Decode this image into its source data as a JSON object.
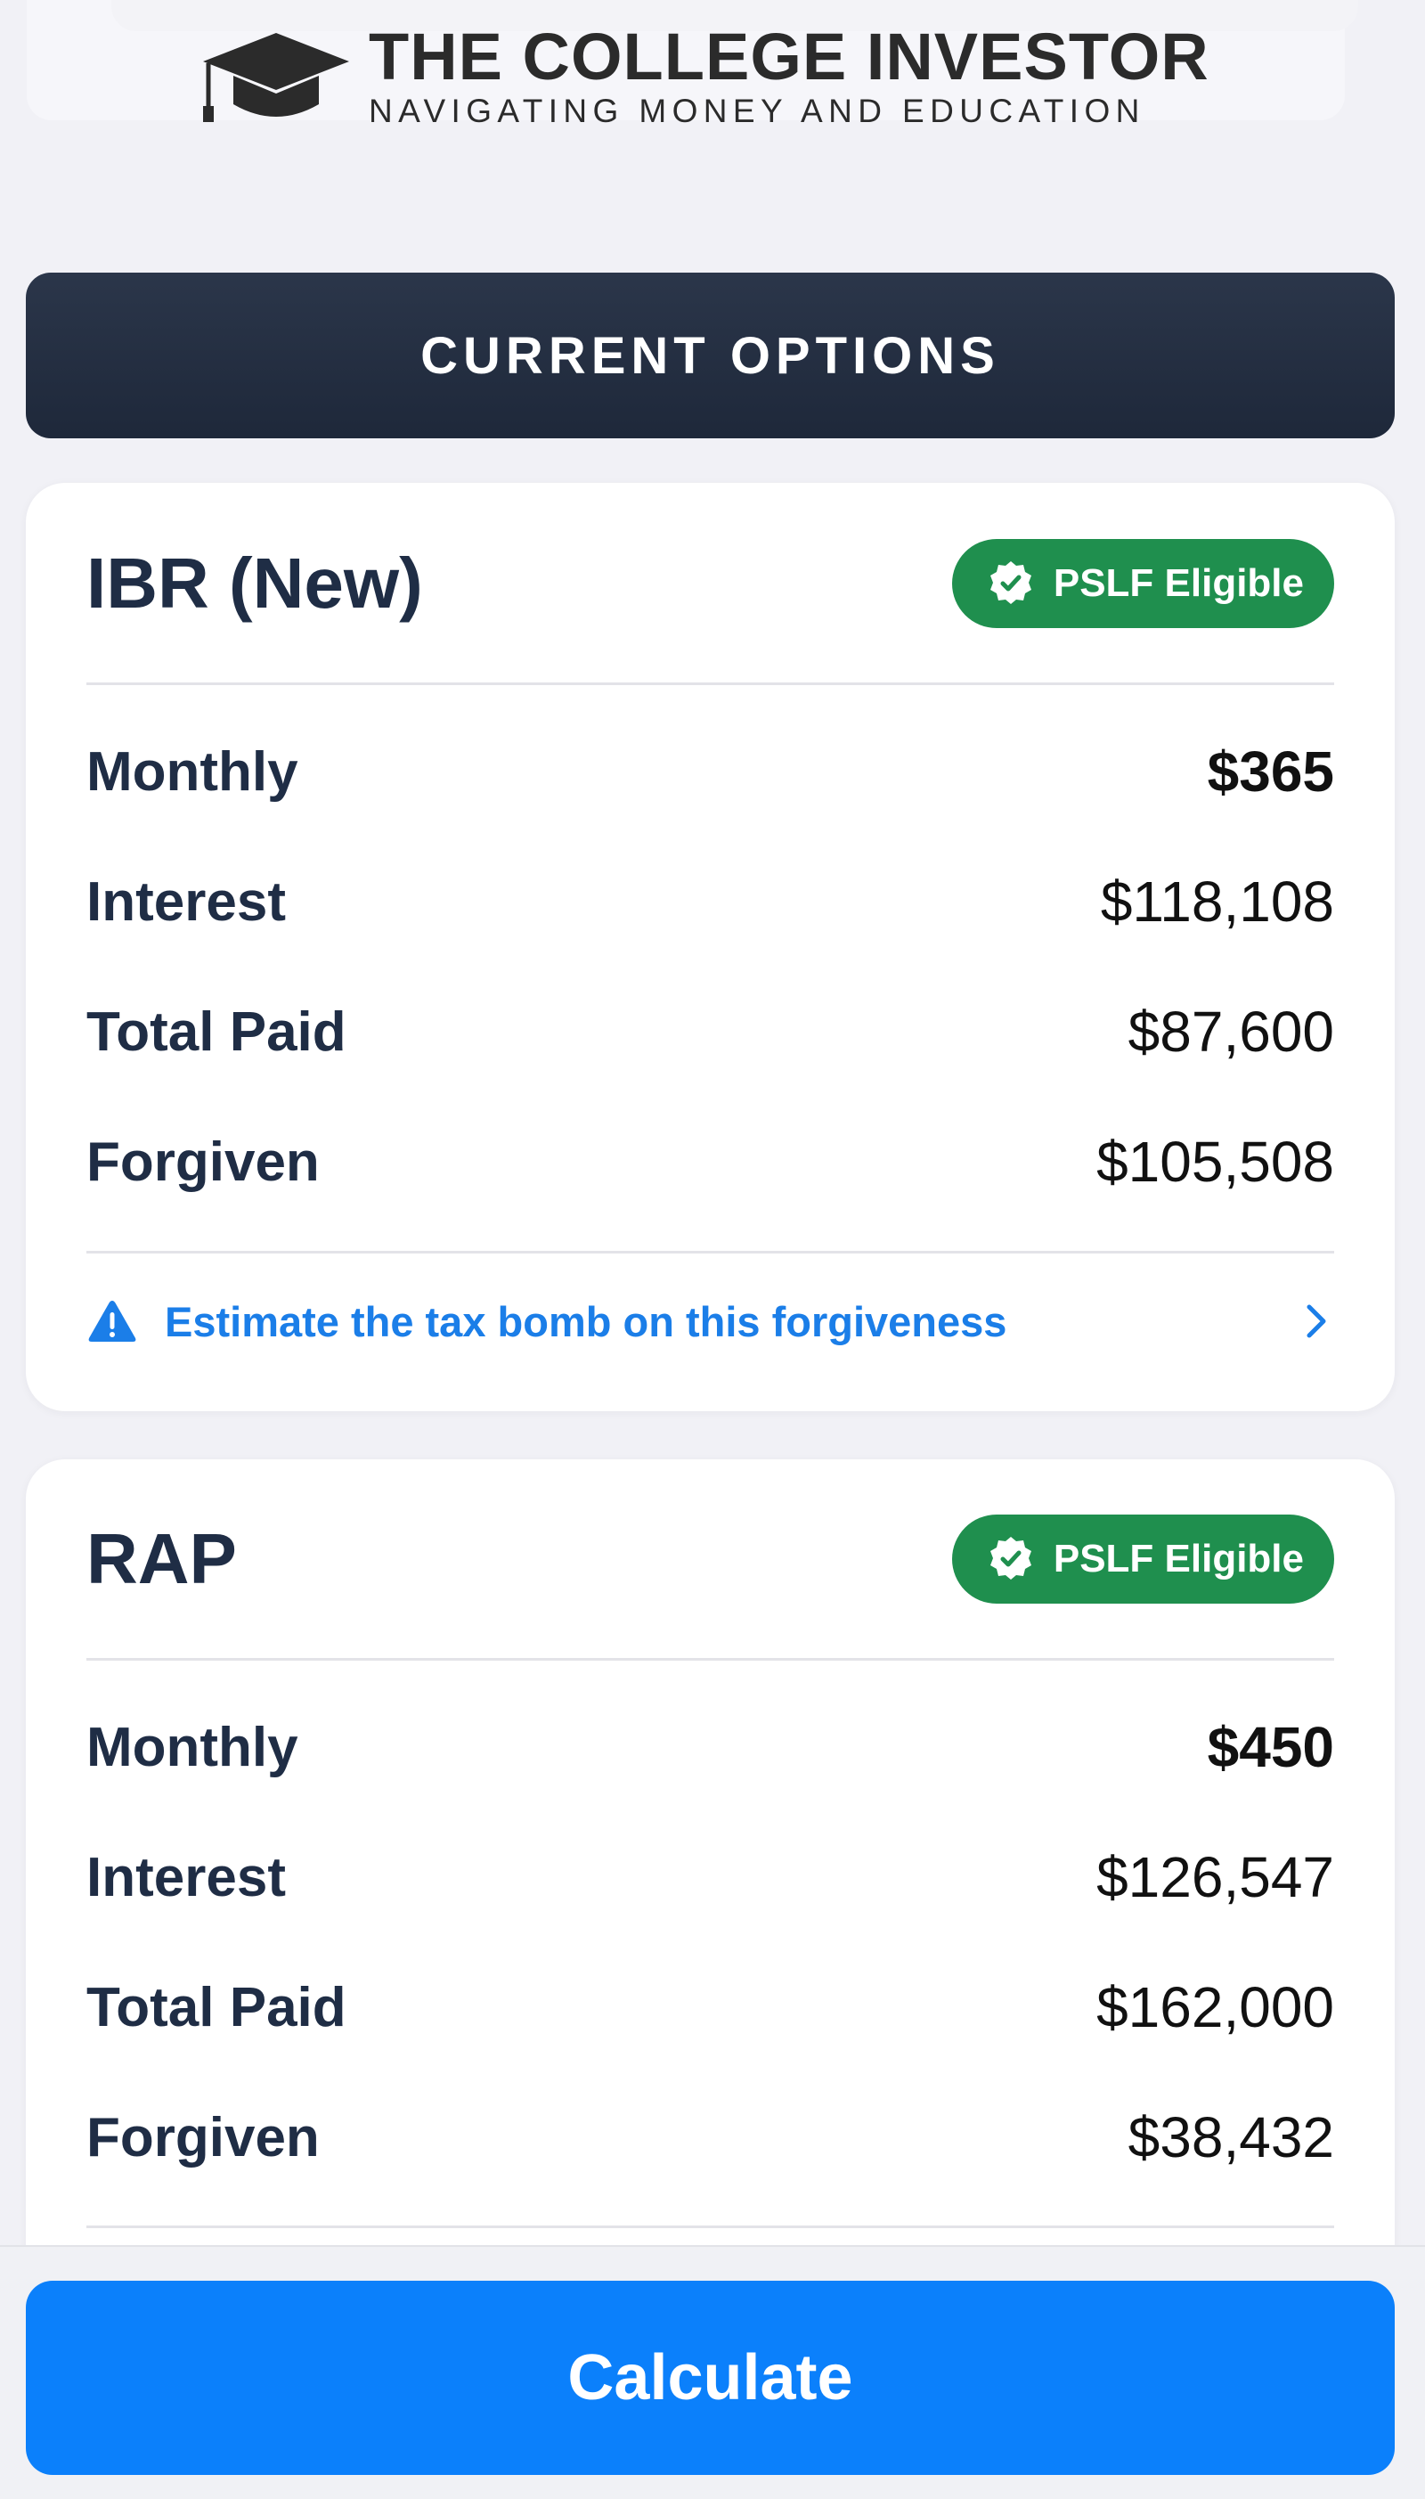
{
  "header": {
    "brand_name": "THE COLLEGE INVESTOR",
    "tagline": "NAVIGATING MONEY AND EDUCATION"
  },
  "section": {
    "title": "CURRENT OPTIONS"
  },
  "plans": [
    {
      "name": "IBR (New)",
      "badge": "PSLF Eligible",
      "rows": [
        {
          "label": "Monthly",
          "value": "$365"
        },
        {
          "label": "Interest",
          "value": "$118,108"
        },
        {
          "label": "Total Paid",
          "value": "$87,600"
        },
        {
          "label": "Forgiven",
          "value": "$105,508"
        }
      ],
      "link": "Estimate the tax bomb on this forgiveness"
    },
    {
      "name": "RAP",
      "badge": "PSLF Eligible",
      "rows": [
        {
          "label": "Monthly",
          "value": "$450"
        },
        {
          "label": "Interest",
          "value": "$126,547"
        },
        {
          "label": "Total Paid",
          "value": "$162,000"
        },
        {
          "label": "Forgiven",
          "value": "$38,432"
        }
      ]
    }
  ],
  "footer": {
    "button_label": "Calculate"
  },
  "colors": {
    "header_bg": "#1e283a",
    "badge_green": "#1f8f4e",
    "link_blue": "#1b7ee8",
    "button_blue": "#0b80fb",
    "page_bg": "#f1f1f6"
  },
  "icons": {
    "logo": "graduation-cap-icon",
    "badge": "verified-check-icon",
    "link_warning": "warning-triangle-icon",
    "link_chevron": "chevron-right-icon"
  }
}
